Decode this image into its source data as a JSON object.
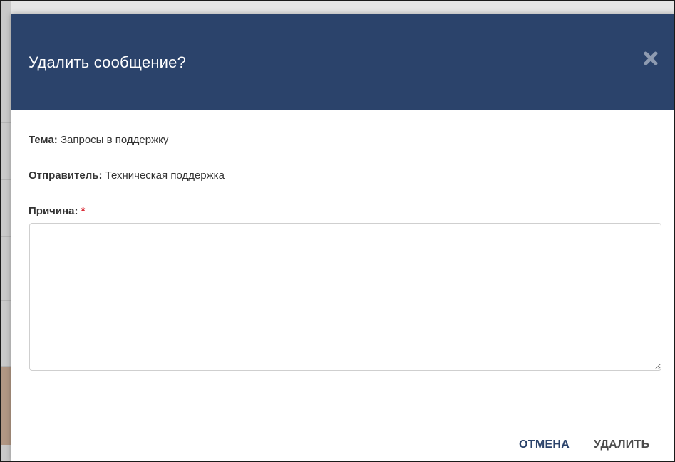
{
  "dialog": {
    "title": "Удалить сообщение?",
    "close_icon": "close-icon"
  },
  "fields": {
    "subject_label": "Тема:",
    "subject_value": "Запросы в поддержку",
    "sender_label": "Отправитель:",
    "sender_value": "Техническая поддержка",
    "reason_label": "Причина:",
    "reason_required_mark": "*",
    "reason_value": ""
  },
  "footer": {
    "cancel_label": "ОТМЕНА",
    "delete_label": "УДАЛИТЬ"
  },
  "colors": {
    "header_bg": "#2b436b",
    "accent": "#2b436b",
    "required": "#d9232e"
  }
}
